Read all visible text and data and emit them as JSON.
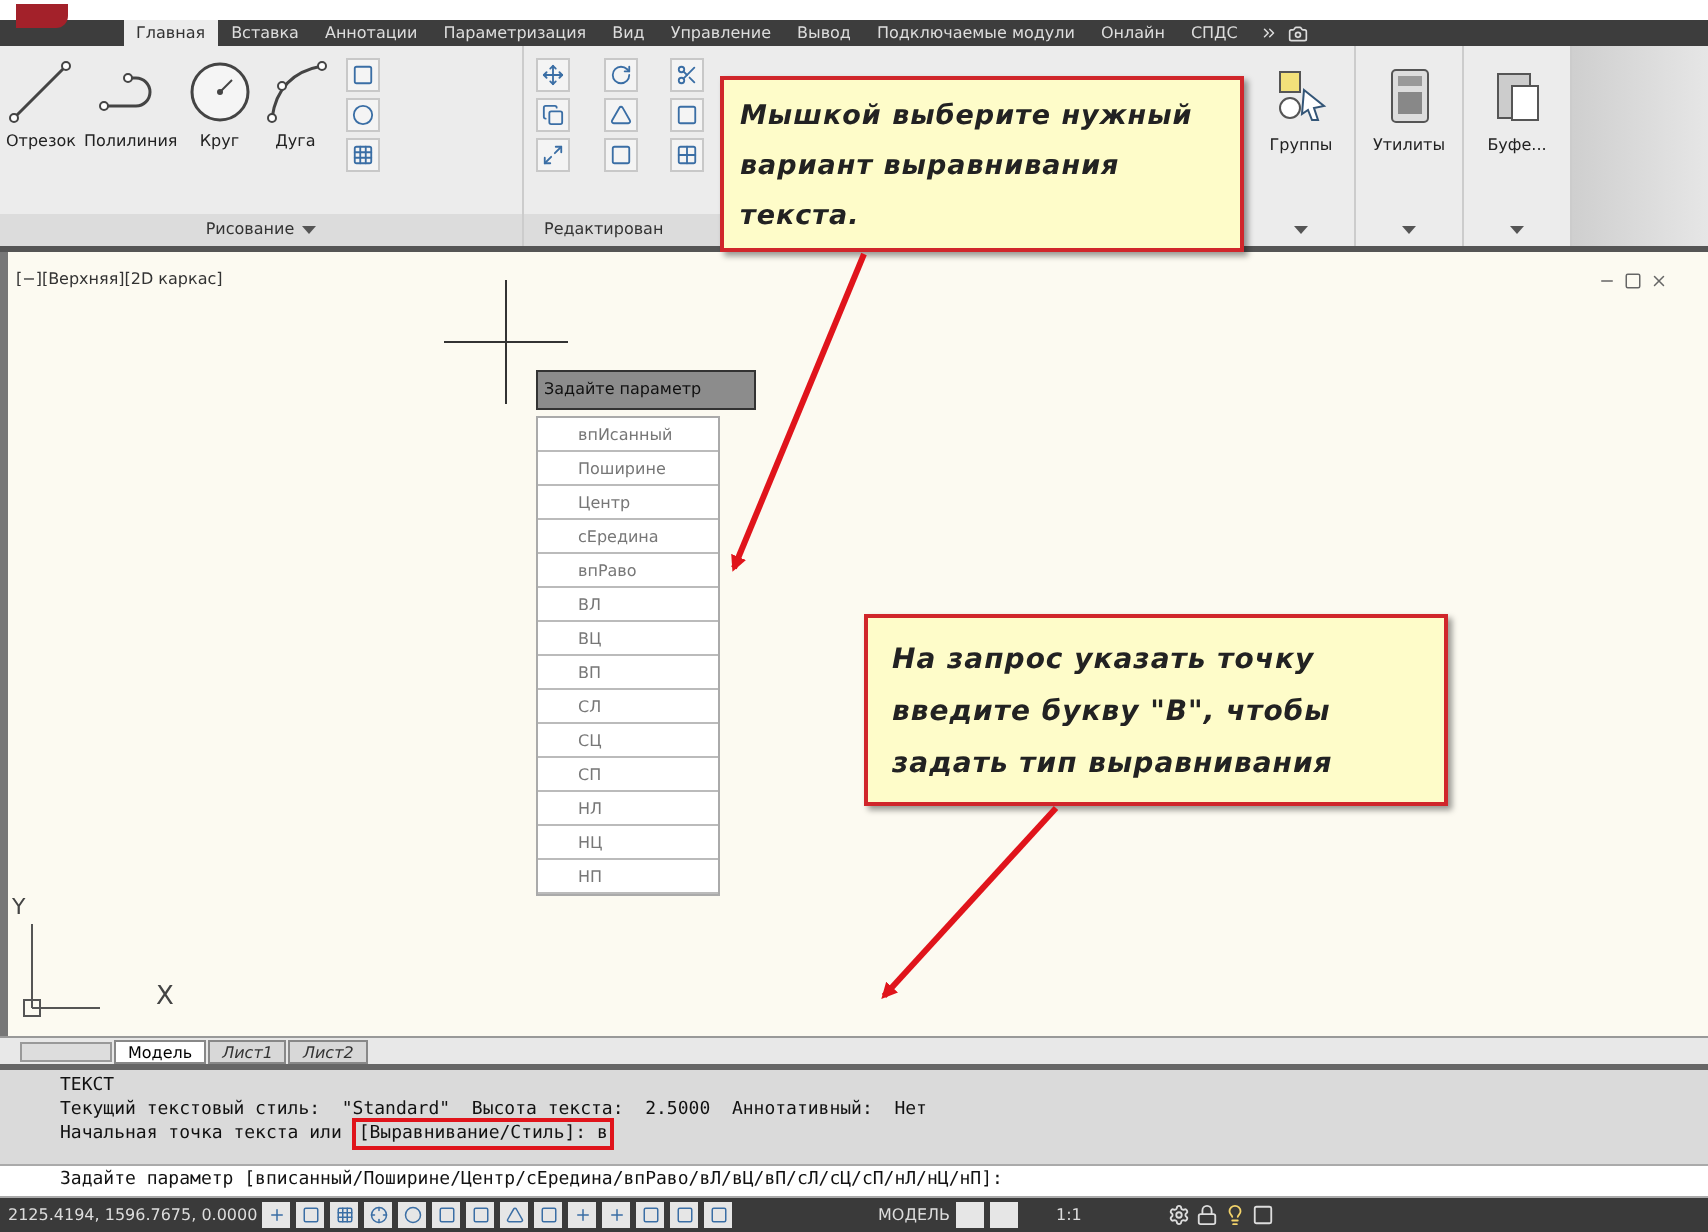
{
  "ribbon": {
    "tabs": [
      {
        "label": "Главная",
        "selected": true
      },
      {
        "label": "Вставка",
        "selected": false
      },
      {
        "label": "Аннотации",
        "selected": false
      },
      {
        "label": "Параметризация",
        "selected": false
      },
      {
        "label": "Вид",
        "selected": false
      },
      {
        "label": "Управление",
        "selected": false
      },
      {
        "label": "Вывод",
        "selected": false
      },
      {
        "label": "Подключаемые модули",
        "selected": false
      },
      {
        "label": "Онлайн",
        "selected": false
      },
      {
        "label": "СПДС",
        "selected": false
      }
    ],
    "draw_tools": [
      {
        "label": "Отрезок",
        "kind": "line"
      },
      {
        "label": "Полилиния",
        "kind": "polyline"
      },
      {
        "label": "Круг",
        "kind": "circle"
      },
      {
        "label": "Дуга",
        "kind": "arc"
      }
    ],
    "draw_panel_label": "Рисование",
    "modify_panel_label": "Редактирован",
    "right_tools": [
      {
        "label": "Группы",
        "kind": "groups"
      },
      {
        "label": "Утилиты",
        "kind": "calculator"
      },
      {
        "label": "Буфе...",
        "kind": "clipboard"
      }
    ]
  },
  "viewport": {
    "label": "[−][Верхняя][2D каркас]",
    "menu": {
      "title": "Задайте параметр",
      "items": [
        "впИсанный",
        "Поширине",
        "Центр",
        "сЕредина",
        "впРаво",
        "ВЛ",
        "ВЦ",
        "ВП",
        "СЛ",
        "СЦ",
        "СП",
        "НЛ",
        "НЦ",
        "НП"
      ]
    },
    "ucs_y": "Y",
    "ucs_x": "X"
  },
  "callouts": [
    "Мышкой выберите нужный вариант выравнивания текста.",
    "На запрос указать точку введите букву \"В\", чтобы задать тип выравнивания"
  ],
  "layout_tabs": [
    {
      "label": "Модель",
      "selected": true
    },
    {
      "label": "Лист1",
      "selected": false
    },
    {
      "label": "Лист2",
      "selected": false
    }
  ],
  "command_line": {
    "history": [
      "ТЕКСТ",
      "Текущий текстовый стиль:  \"Standard\"  Высота текста:  2.5000  Аннотативный:  Нет"
    ],
    "last_prefix": "Начальная точка текста или",
    "last_highlight": "[Выравнивание/Стиль]: в",
    "prompt": "Задайте параметр [вписанный/Поширине/Центр/сЕредина/впРаво/вЛ/вЦ/вП/сЛ/сЦ/сП/нЛ/нЦ/нП]:"
  },
  "status_bar": {
    "coordinates": "2125.4194, 1596.7675, 0.0000",
    "model": "МОДЕЛЬ",
    "scale": "1:1"
  }
}
